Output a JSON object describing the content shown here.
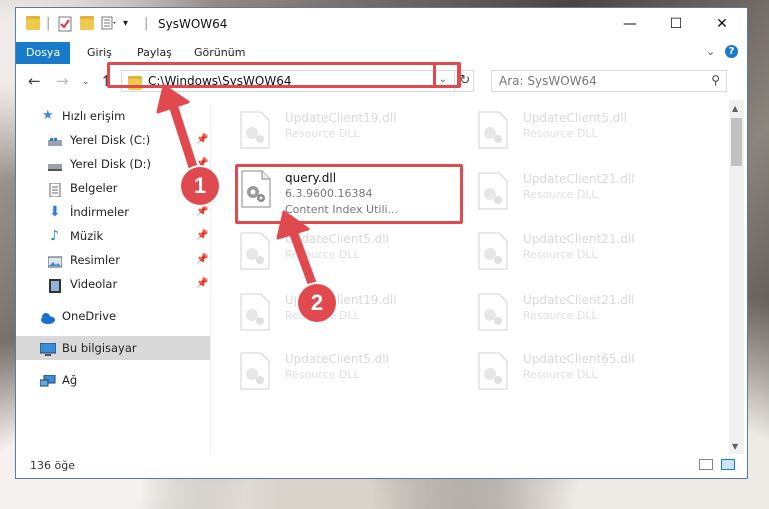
{
  "window": {
    "title": "SysWOW64",
    "controls": {
      "minimize": "—",
      "maximize": "☐",
      "close": "✕"
    }
  },
  "ribbon": {
    "tabs": [
      {
        "label": "Dosya",
        "active": true
      },
      {
        "label": "Giriş",
        "active": false
      },
      {
        "label": "Paylaş",
        "active": false
      },
      {
        "label": "Görünüm",
        "active": false
      }
    ],
    "help": "?"
  },
  "address": {
    "path": "C:\\Windows\\SysWOW64",
    "search_placeholder": "Ara: SysWOW64"
  },
  "sidebar": {
    "items": [
      {
        "label": "Hızlı erişim",
        "icon": "star-icon"
      },
      {
        "label": "Yerel Disk (C:)",
        "icon": "drive-icon",
        "pinned": true
      },
      {
        "label": "Yerel Disk (D:)",
        "icon": "drive-icon",
        "pinned": true
      },
      {
        "label": "Belgeler",
        "icon": "document-icon",
        "pinned": true
      },
      {
        "label": "İndirmeler",
        "icon": "download-icon",
        "pinned": true
      },
      {
        "label": "Müzik",
        "icon": "music-icon",
        "pinned": true
      },
      {
        "label": "Resimler",
        "icon": "pictures-icon",
        "pinned": true
      },
      {
        "label": "Videolar",
        "icon": "video-icon",
        "pinned": true
      },
      {
        "label": "OneDrive",
        "icon": "cloud-icon"
      },
      {
        "label": "Bu bilgisayar",
        "icon": "computer-icon",
        "selected": true
      },
      {
        "label": "Ağ",
        "icon": "network-icon"
      }
    ]
  },
  "files": {
    "left": [
      {
        "name": "UpdateClient19.dll",
        "desc": "Resource DLL"
      },
      {
        "name": "UpdateClient5.dll",
        "desc": "Resource DLL"
      },
      {
        "name": "UpdateClient19.dll",
        "desc": "Resource DLL"
      },
      {
        "name": "UpdateClient5.dll",
        "desc": "Resource DLL"
      }
    ],
    "right": [
      {
        "name": "UpdateClient5.dll",
        "desc": "Resource DLL"
      },
      {
        "name": "UpdateClient21.dll",
        "desc": "Resource DLL"
      },
      {
        "name": "UpdateClient21.dll",
        "desc": "Resource DLL"
      },
      {
        "name": "UpdateClient21.dll",
        "desc": "Resource DLL"
      },
      {
        "name": "UpdateClient65.dll",
        "desc": "Resource DLL"
      }
    ],
    "highlighted": {
      "name": "query.dll",
      "version": "6.3.9600.16384",
      "desc": "Content Index Utili..."
    }
  },
  "status": {
    "count": "136 öğe"
  },
  "annotations": {
    "step1": "1",
    "step2": "2",
    "color": "#e04a4e"
  }
}
